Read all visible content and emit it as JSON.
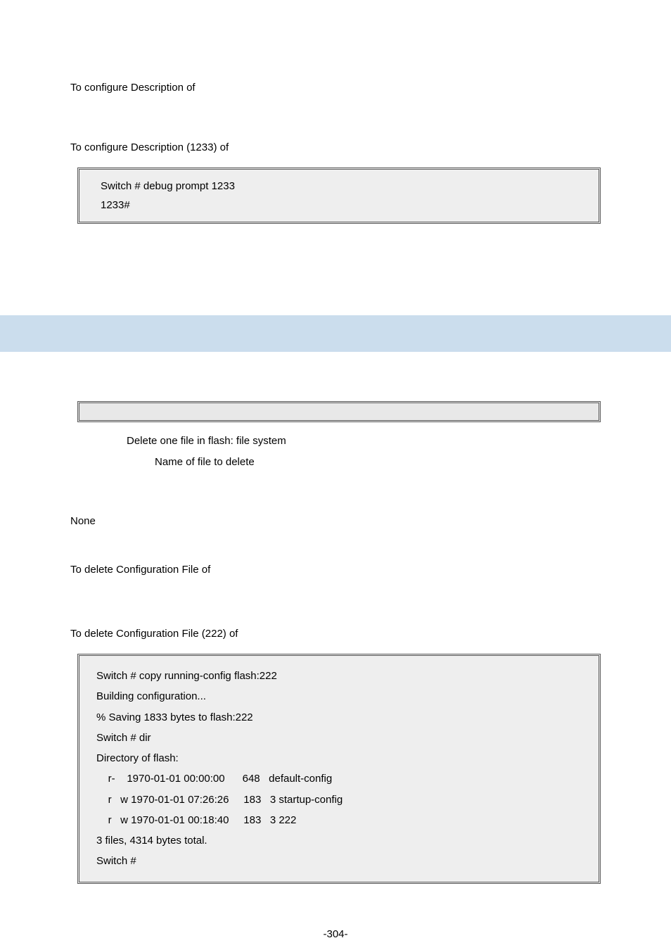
{
  "para1": "To configure Description of",
  "para2": "To configure Description (1233) of",
  "code1": {
    "l1": "Switch # debug prompt 1233",
    "l2": "1233#"
  },
  "desc": {
    "term": "Delete one file in flash: file system",
    "sub": "Name of file to delete"
  },
  "none": "None",
  "para3": "To delete Configuration File of",
  "para4": "To delete Configuration File (222) of",
  "code2": {
    "l1": "Switch # copy running-config flash:222",
    "l2": "Building configuration...",
    "l3": "% Saving 1833 bytes to flash:222",
    "l4": "Switch # dir",
    "l5": "Directory of flash:",
    "l6": "    r-    1970-01-01 00:00:00      648   default-config",
    "l7": "    r   w 1970-01-01 07:26:26     183   3 startup-config",
    "l8": "    r   w 1970-01-01 00:18:40     183   3 222",
    "l9": "3 files, 4314 bytes total.",
    "l10": "Switch #"
  },
  "page_number": "-304-"
}
